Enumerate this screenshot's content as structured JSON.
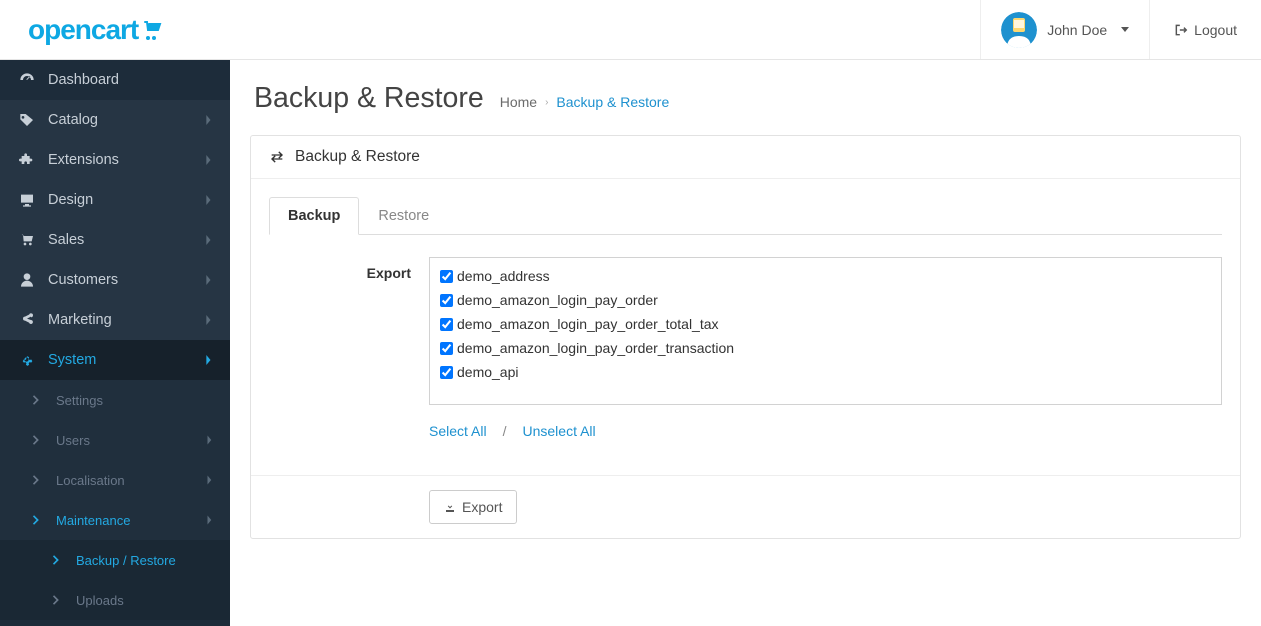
{
  "brand": {
    "name": "opencart"
  },
  "header": {
    "user_name": "John Doe",
    "logout_label": "Logout"
  },
  "sidebar": {
    "items": [
      {
        "id": "dashboard",
        "label": "Dashboard",
        "icon": "dashboard",
        "expandable": false
      },
      {
        "id": "catalog",
        "label": "Catalog",
        "icon": "tag",
        "expandable": true
      },
      {
        "id": "extensions",
        "label": "Extensions",
        "icon": "puzzle",
        "expandable": true
      },
      {
        "id": "design",
        "label": "Design",
        "icon": "desktop",
        "expandable": true
      },
      {
        "id": "sales",
        "label": "Sales",
        "icon": "cart",
        "expandable": true
      },
      {
        "id": "customers",
        "label": "Customers",
        "icon": "user",
        "expandable": true
      },
      {
        "id": "marketing",
        "label": "Marketing",
        "icon": "share",
        "expandable": true
      },
      {
        "id": "system",
        "label": "System",
        "icon": "cog",
        "expandable": true,
        "active": true
      }
    ],
    "system_sub": [
      {
        "id": "settings",
        "label": "Settings",
        "has_child": false
      },
      {
        "id": "users",
        "label": "Users",
        "has_child": true
      },
      {
        "id": "localisation",
        "label": "Localisation",
        "has_child": true
      },
      {
        "id": "maintenance",
        "label": "Maintenance",
        "has_child": true,
        "active": true
      }
    ],
    "maintenance_sub": [
      {
        "id": "backup",
        "label": "Backup / Restore",
        "active": true
      },
      {
        "id": "uploads",
        "label": "Uploads",
        "active": false
      }
    ]
  },
  "page": {
    "title": "Backup & Restore",
    "breadcrumb": {
      "home": "Home",
      "current": "Backup & Restore"
    }
  },
  "panel": {
    "title": "Backup & Restore",
    "tabs": {
      "backup": "Backup",
      "restore": "Restore"
    },
    "export_label": "Export",
    "tables": [
      "demo_address",
      "demo_amazon_login_pay_order",
      "demo_amazon_login_pay_order_total_tax",
      "demo_amazon_login_pay_order_transaction",
      "demo_api"
    ],
    "select_all": "Select All",
    "unselect_all": "Unselect All",
    "divider": "/",
    "export_button": "Export"
  }
}
